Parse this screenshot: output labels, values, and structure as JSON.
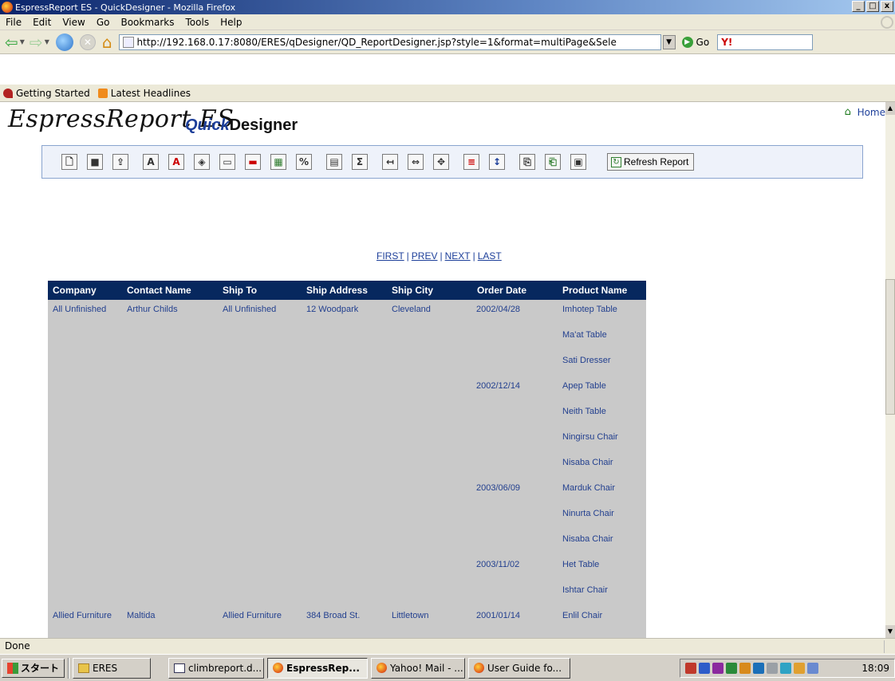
{
  "window": {
    "title": "EspressReport ES - QuickDesigner - Mozilla Firefox",
    "controls": [
      "_",
      "□",
      "x"
    ]
  },
  "menu": [
    "File",
    "Edit",
    "View",
    "Go",
    "Bookmarks",
    "Tools",
    "Help"
  ],
  "nav": {
    "url": "http://192.168.0.17:8080/ERES/qDesigner/QD_ReportDesigner.jsp?style=1&format=multiPage&Sele",
    "go_label": "Go",
    "search_logo": "Y!"
  },
  "bookmarks": [
    "Getting Started",
    "Latest Headlines"
  ],
  "page": {
    "logo_main": "EspressReport ES",
    "logo_quick": "Quick",
    "logo_designer": "Designer",
    "home_link": "Home",
    "refresh_label": "Refresh Report",
    "toolbar_icons": [
      "new-report-icon",
      "save-icon",
      "export-icon",
      "font-icon",
      "font-color-icon",
      "fill-color-icon",
      "border-icon",
      "table-border-icon",
      "insert-chart-icon",
      "percent-format-icon",
      "data-field-icon",
      "summary-icon",
      "insert-column-icon",
      "column-width-icon",
      "alignment-icon",
      "sort-icon",
      "sort-order-icon",
      "copy-icon",
      "paste-icon",
      "preview-icon"
    ],
    "toolbar_glyphs": [
      "🗋",
      "■",
      "⇪",
      "A",
      "A",
      "◈",
      "▭",
      "▬",
      "▦",
      "%",
      "▤",
      "Σ",
      "↤",
      "⇔",
      "✥",
      "≡",
      "↕",
      "⎘",
      "⎗",
      "▣"
    ]
  },
  "pager": {
    "first": "FIRST",
    "prev": "PREV",
    "next": "NEXT",
    "last": "LAST",
    "sep": "|"
  },
  "report": {
    "columns": [
      "Company",
      "Contact Name",
      "Ship To",
      "Ship Address",
      "Ship City",
      "Order Date",
      "Product Name"
    ],
    "rows": [
      [
        "All Unfinished",
        "Arthur Childs",
        "All Unfinished",
        "12 Woodpark",
        "Cleveland",
        "2002/04/28",
        "Imhotep Table"
      ],
      [
        "",
        "",
        "",
        "",
        "",
        "",
        "Ma'at Table"
      ],
      [
        "",
        "",
        "",
        "",
        "",
        "",
        "Sati Dresser"
      ],
      [
        "",
        "",
        "",
        "",
        "",
        "2002/12/14",
        "Apep Table"
      ],
      [
        "",
        "",
        "",
        "",
        "",
        "",
        "Neith Table"
      ],
      [
        "",
        "",
        "",
        "",
        "",
        "",
        "Ningirsu Chair"
      ],
      [
        "",
        "",
        "",
        "",
        "",
        "",
        "Nisaba Chair"
      ],
      [
        "",
        "",
        "",
        "",
        "",
        "2003/06/09",
        "Marduk Chair"
      ],
      [
        "",
        "",
        "",
        "",
        "",
        "",
        "Ninurta Chair"
      ],
      [
        "",
        "",
        "",
        "",
        "",
        "",
        "Nisaba Chair"
      ],
      [
        "",
        "",
        "",
        "",
        "",
        "2003/11/02",
        "Het Table"
      ],
      [
        "",
        "",
        "",
        "",
        "",
        "",
        "Ishtar Chair"
      ],
      [
        "Allied Furniture",
        "Maltida",
        "Allied Furniture",
        "384 Broad St.",
        "Littletown",
        "2001/01/14",
        "Enlil Chair"
      ]
    ]
  },
  "status": "Done",
  "taskbar": {
    "start": "スタート",
    "tasks": [
      {
        "label": "ERES",
        "icon": "folder"
      },
      {
        "label": "climbreport.d...",
        "icon": "doc"
      },
      {
        "label": "EspressRep...",
        "icon": "ff",
        "active": true
      },
      {
        "label": "Yahoo! Mail - ...",
        "icon": "ff"
      },
      {
        "label": "User Guide fo...",
        "icon": "ff"
      }
    ],
    "clock": "18:09"
  }
}
